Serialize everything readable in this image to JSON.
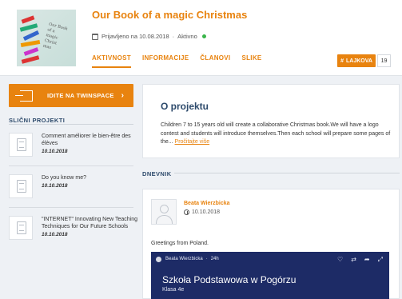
{
  "project": {
    "title": "Our Book of a magic Christmas",
    "registered_label": "Prijavljeno na 10.08.2018",
    "status_separator": "·",
    "status": "Aktivno"
  },
  "tabs": [
    {
      "label": "AKTIVNOST",
      "active": true
    },
    {
      "label": "INFORMACIJE",
      "active": false
    },
    {
      "label": "ČLANOVI",
      "active": false
    },
    {
      "label": "SLIKE",
      "active": false
    }
  ],
  "like": {
    "label": "LAJKOVA",
    "icon": "hash-icon",
    "count": "19"
  },
  "twinspace_button": {
    "label": "IDITE NA TWINSPACE",
    "chevron": "›"
  },
  "similar_projects": {
    "title": "SLIČNI PROJEKTI",
    "items": [
      {
        "title": "Comment améliorer le bien-être des élèves",
        "date": "10.10.2018"
      },
      {
        "title": "Do you know me?",
        "date": "10.10.2018"
      },
      {
        "title": "\"INTERNET\" Innovating New Teaching Techniques for Our Future Schools",
        "date": "10.10.2018"
      }
    ]
  },
  "about": {
    "heading": "O projektu",
    "text": "Children 7 to 15 years old will create a collaborative Christmas book.We will have a logo contest and students will introduce themselves.Then each school will prepare some pages of the...",
    "read_more": "Pročitajte više"
  },
  "journal": {
    "title": "DNEVNIK",
    "post": {
      "author": "Beata Wierzbicka",
      "date": "10.10.2018",
      "text": "Greetings from Poland.",
      "embed": {
        "author": "Beata Wierzbicka",
        "separator": "·",
        "age": "24h",
        "title": "Szkoła Podstawowa w Pogórzu",
        "subtitle": "Klasa 4e",
        "icons": [
          "heart-icon",
          "repost-icon",
          "share-icon",
          "expand-icon"
        ]
      }
    }
  },
  "cover_text": [
    "Our Book",
    "of a",
    "magic",
    "Christ",
    "mas"
  ],
  "colors": {
    "accent": "#e8830f",
    "heading": "#2d4a6b",
    "status": "#3ab54a",
    "embed_bg": "#1d2b66"
  }
}
